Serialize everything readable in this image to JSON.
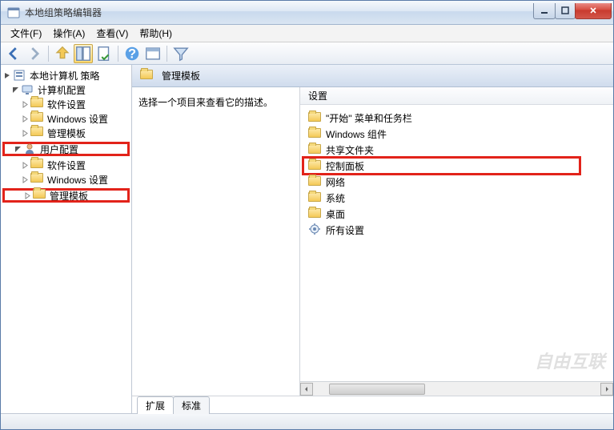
{
  "window": {
    "title": "本地组策略编辑器"
  },
  "menu": {
    "file": "文件(F)",
    "action": "操作(A)",
    "view": "查看(V)",
    "help": "帮助(H)"
  },
  "tree": {
    "root": "本地计算机 策略",
    "computer_config": "计算机配置",
    "computer_children": {
      "software": "软件设置",
      "windows": "Windows 设置",
      "admin_templates": "管理模板"
    },
    "user_config": "用户配置",
    "user_children": {
      "software": "软件设置",
      "windows": "Windows 设置",
      "admin_templates": "管理模板"
    }
  },
  "content": {
    "header": "管理模板",
    "description_prompt": "选择一个项目来查看它的描述。",
    "list_header": "设置",
    "items": [
      {
        "label": "\"开始\" 菜单和任务栏",
        "icon": "folder"
      },
      {
        "label": "Windows 组件",
        "icon": "folder"
      },
      {
        "label": "共享文件夹",
        "icon": "folder"
      },
      {
        "label": "控制面板",
        "icon": "folder"
      },
      {
        "label": "网络",
        "icon": "folder"
      },
      {
        "label": "系统",
        "icon": "folder"
      },
      {
        "label": "桌面",
        "icon": "folder"
      },
      {
        "label": "所有设置",
        "icon": "settings"
      }
    ],
    "tabs": {
      "extended": "扩展",
      "standard": "标准"
    }
  },
  "watermark": "自由互联"
}
